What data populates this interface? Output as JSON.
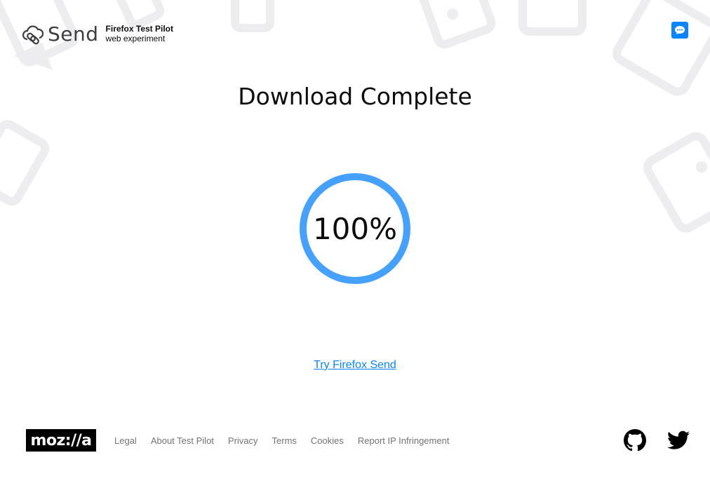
{
  "header": {
    "brand_name": "Send",
    "sub_title": "Firefox Test Pilot",
    "sub_caption": "web experiment",
    "logo_icon": "send-cloud-link-icon",
    "feedback_icon": "chat-bubble-icon"
  },
  "main": {
    "title": "Download Complete",
    "progress_percent": 100,
    "progress_label": "100%",
    "cta_link": "Try Firefox Send"
  },
  "footer": {
    "logo": "moz://a",
    "links": [
      "Legal",
      "About Test Pilot",
      "Privacy",
      "Terms",
      "Cookies",
      "Report IP Infringement"
    ],
    "social": [
      "github-icon",
      "twitter-icon"
    ]
  },
  "colors": {
    "accent": "#0a84ff",
    "progress_ring": "#45a1ff",
    "footer_text": "#737373",
    "decor": "#efeff0"
  }
}
